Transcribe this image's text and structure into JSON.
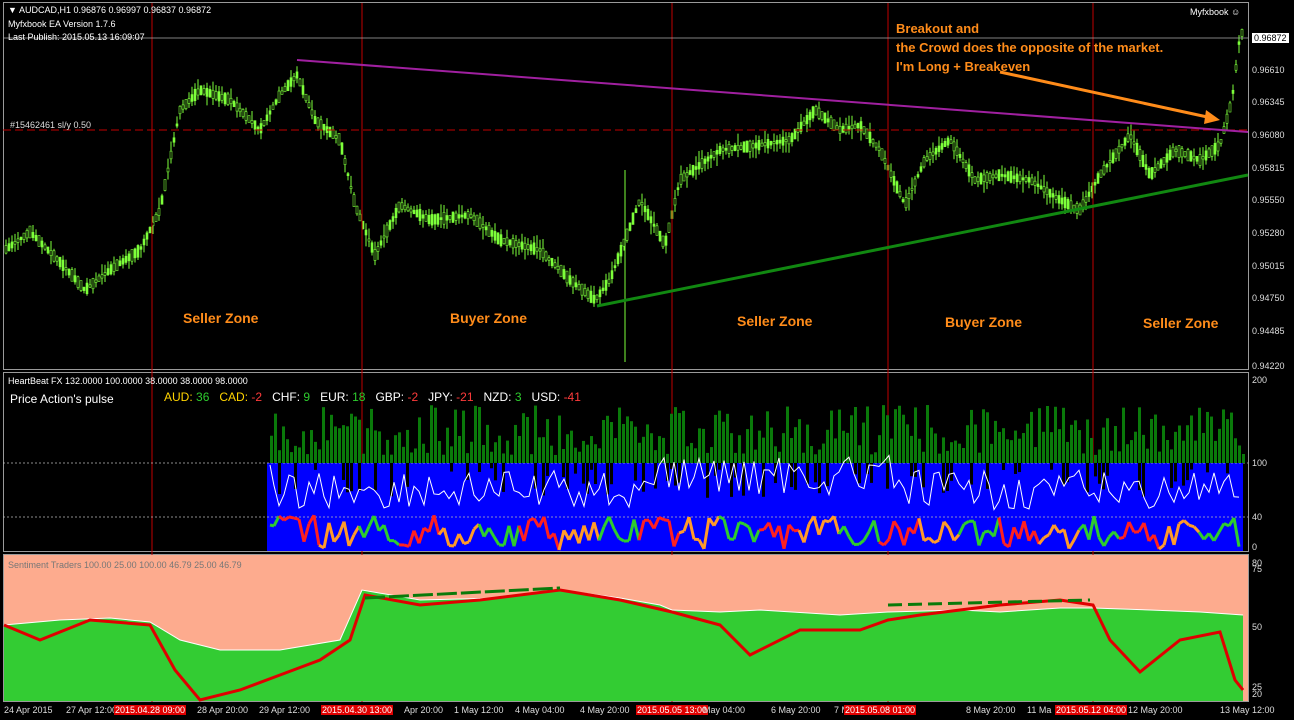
{
  "header": {
    "symbol_line": "AUDCAD,H1  0.96876 0.96997 0.96837 0.96872",
    "ea_version": "Myfxbook EA Version 1.7.6",
    "last_publish": "Last Publish: 2015.05.13 16:09:07",
    "brand": "Myfxbook",
    "order_label": "#15462461 sl/y 0.50"
  },
  "annotation": {
    "line1": "Breakout and",
    "line2": "the Crowd does the opposite of the market.",
    "line3": "I'm Long + Breakeven"
  },
  "zones": [
    "Seller Zone",
    "Buyer Zone",
    "Seller Zone",
    "Buyer Zone",
    "Seller Zone"
  ],
  "price_axis": [
    "0.96872",
    "0.96610",
    "0.96345",
    "0.96080",
    "0.95815",
    "0.95550",
    "0.95280",
    "0.95015",
    "0.94750",
    "0.94485",
    "0.94220"
  ],
  "heartbeat": {
    "title": "HeartBeat FX 132.0000 100.0000 38.0000 38.0000 98.0000",
    "subtitle": "Price Action's pulse",
    "currencies": [
      {
        "name": "AUD:",
        "value": "36",
        "color": "#2ecc2e"
      },
      {
        "name": "CAD:",
        "value": "-2",
        "color": "#ff3b3b"
      },
      {
        "name": "CHF:",
        "value": "9",
        "color": "#2ecc2e"
      },
      {
        "name": "EUR:",
        "value": "18",
        "color": "#2ecc2e"
      },
      {
        "name": "GBP:",
        "value": "-2",
        "color": "#ff3b3b"
      },
      {
        "name": "JPY:",
        "value": "-21",
        "color": "#ff3b3b"
      },
      {
        "name": "NZD:",
        "value": "3",
        "color": "#2ecc2e"
      },
      {
        "name": "USD:",
        "value": "-41",
        "color": "#ff3b3b"
      }
    ],
    "axis": [
      "200",
      "100",
      "40",
      "0"
    ]
  },
  "sentiment": {
    "title": "Sentiment Traders 100.00 25.00 100.00 46.79 25.00 46.79",
    "axis": [
      "80",
      "75",
      "50",
      "25",
      "20"
    ]
  },
  "time_axis": [
    {
      "label": "24 Apr 2015",
      "hl": false
    },
    {
      "label": "27 Apr 12:00",
      "hl": false
    },
    {
      "label": "2015.04.28 09:00",
      "hl": true
    },
    {
      "label": "28 Apr 20:00",
      "hl": false
    },
    {
      "label": "29 Apr 12:00",
      "hl": false
    },
    {
      "label": "2015.04.30 13:00",
      "hl": true
    },
    {
      "label": "Apr 20:00",
      "hl": false
    },
    {
      "label": "1 May 12:00",
      "hl": false
    },
    {
      "label": "4 May 04:00",
      "hl": false
    },
    {
      "label": "4 May 20:00",
      "hl": false
    },
    {
      "label": "2015.05.05 13:00",
      "hl": true
    },
    {
      "label": "May 04:00",
      "hl": false
    },
    {
      "label": "6 May 20:00",
      "hl": false
    },
    {
      "label": "7 M",
      "hl": false
    },
    {
      "label": "2015.05.08 01:00",
      "hl": true
    },
    {
      "label": "8 May 20:00",
      "hl": false
    },
    {
      "label": "11 Ma",
      "hl": false
    },
    {
      "label": "2015.05.12 04:00",
      "hl": true
    },
    {
      "label": "12 May 20:00",
      "hl": false
    },
    {
      "label": "13 May 12:00",
      "hl": false
    }
  ]
}
